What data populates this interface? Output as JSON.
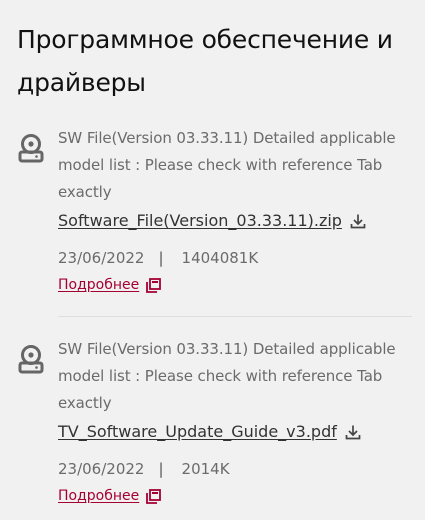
{
  "section": {
    "title": "Программное обеспечение и драйверы"
  },
  "items": [
    {
      "description": "SW File(Version 03.33.11) Detailed applicable model list : Please check with reference Tab exactly",
      "file_name": "Software_File(Version_03.33.11).zip",
      "date": "23/06/2022",
      "separator": "|",
      "size": "1404081K",
      "more_label": "Подробнее",
      "icon": "disk-icon",
      "download_icon": "download-icon",
      "more_icon": "open-window-icon"
    },
    {
      "description": "SW File(Version 03.33.11) Detailed applicable model list : Please check with reference Tab exactly",
      "file_name": "TV_Software_Update_Guide_v3.pdf",
      "date": "23/06/2022",
      "separator": "|",
      "size": "2014K",
      "more_label": "Подробнее",
      "icon": "disk-icon",
      "download_icon": "download-icon",
      "more_icon": "open-window-icon"
    }
  ],
  "colors": {
    "accent": "#a50034",
    "text": "#333333",
    "muted": "#6b6b6b",
    "background": "#f1f1f1"
  }
}
